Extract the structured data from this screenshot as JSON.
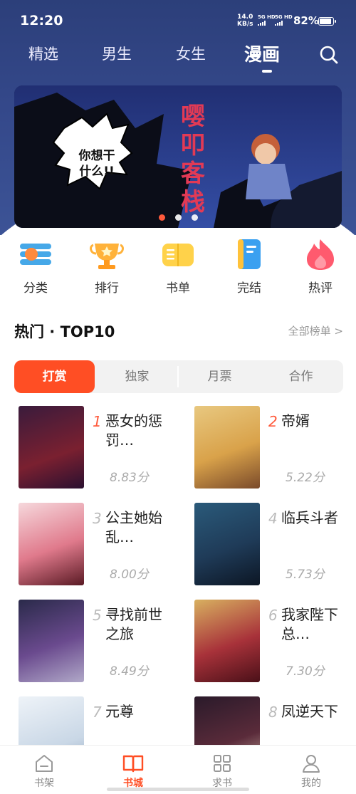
{
  "status_bar": {
    "time": "12:20",
    "speed_value": "14.0",
    "speed_unit": "KB/s",
    "sim1": "5G HD",
    "sim2": "5G HD",
    "battery": "82%"
  },
  "top_tabs": [
    {
      "label": "精选",
      "active": false
    },
    {
      "label": "男生",
      "active": false
    },
    {
      "label": "女生",
      "active": false
    },
    {
      "label": "漫画",
      "active": true
    }
  ],
  "banner": {
    "speech_line1": "你想干",
    "speech_line2": "什么!!",
    "title_glyphs": [
      "嘤",
      "叩",
      "客",
      "栈"
    ],
    "dots": 3,
    "active_dot": 0
  },
  "categories": [
    {
      "label": "分类",
      "icon": "category-icon"
    },
    {
      "label": "排行",
      "icon": "trophy-icon"
    },
    {
      "label": "书单",
      "icon": "book-list-icon"
    },
    {
      "label": "完结",
      "icon": "finished-book-icon"
    },
    {
      "label": "热评",
      "icon": "flame-icon"
    }
  ],
  "section": {
    "title": "热门 · TOP10",
    "more": "全部榜单 >"
  },
  "sub_tabs": [
    {
      "label": "打赏",
      "active": true
    },
    {
      "label": "独家",
      "active": false
    },
    {
      "label": "月票",
      "active": false
    },
    {
      "label": "合作",
      "active": false
    }
  ],
  "rankings": [
    {
      "rank": "1",
      "title": "恶女的惩罚…",
      "score": "8.83分",
      "cover": "#7a2030"
    },
    {
      "rank": "2",
      "title": "帝婿",
      "score": "5.22分",
      "cover": "#d9a24a"
    },
    {
      "rank": "3",
      "title": "公主她始乱…",
      "score": "8.00分",
      "cover": "#e07a8c"
    },
    {
      "rank": "4",
      "title": "临兵斗者",
      "score": "5.73分",
      "cover": "#1f3b58"
    },
    {
      "rank": "5",
      "title": "寻找前世之旅",
      "score": "8.49分",
      "cover": "#6a4a8e"
    },
    {
      "rank": "6",
      "title": "我家陛下总…",
      "score": "7.30分",
      "cover": "#a8323a"
    },
    {
      "rank": "7",
      "title": "元尊",
      "score": "",
      "cover": "#c9d7e6"
    },
    {
      "rank": "8",
      "title": "凤逆天下",
      "score": "",
      "cover": "#5a2b3a"
    }
  ],
  "bottom_nav": [
    {
      "label": "书架",
      "icon": "bookshelf-icon",
      "active": false
    },
    {
      "label": "书城",
      "icon": "open-book-icon",
      "active": true
    },
    {
      "label": "求书",
      "icon": "grid-icon",
      "active": false
    },
    {
      "label": "我的",
      "icon": "user-icon",
      "active": false
    }
  ],
  "colors": {
    "accent": "#ff4e24",
    "header": "#34488a",
    "rank_top": "#ff5a3c"
  }
}
